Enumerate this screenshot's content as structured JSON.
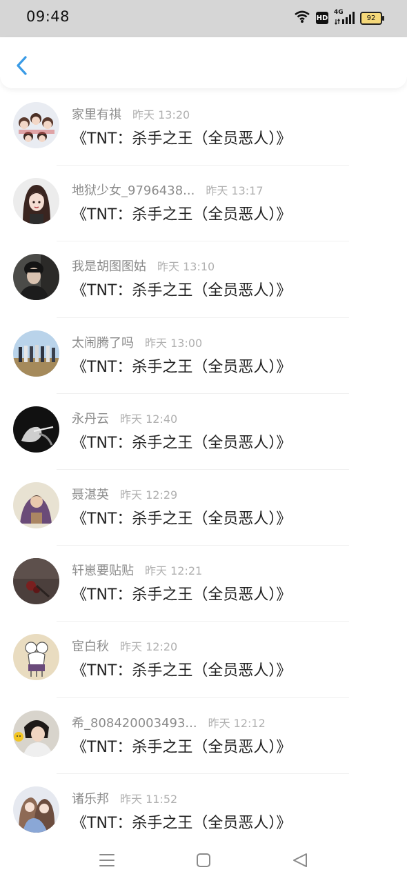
{
  "status_bar": {
    "time": "09:48",
    "network": "4G",
    "hd": "HD",
    "battery": "92"
  },
  "header": {
    "back_icon": "chevron-left-icon",
    "accent": "#3a9be6"
  },
  "messages": [
    {
      "nickname": "家里有祺",
      "time": "昨天 13:20",
      "text": "《TNT：杀手之王（全员恶人）》"
    },
    {
      "nickname": "地狱少女_9796438...",
      "time": "昨天 13:17",
      "text": "《TNT：杀手之王（全员恶人）》"
    },
    {
      "nickname": "我是胡图图姑",
      "time": "昨天 13:10",
      "text": "《TNT：杀手之王（全员恶人）》"
    },
    {
      "nickname": "太闹腾了吗",
      "time": "昨天 13:00",
      "text": "《TNT：杀手之王（全员恶人）》"
    },
    {
      "nickname": "永丹云",
      "time": "昨天 12:40",
      "text": "《TNT：杀手之王（全员恶人）》"
    },
    {
      "nickname": "聂湛英",
      "time": "昨天 12:29",
      "text": "《TNT：杀手之王（全员恶人）》"
    },
    {
      "nickname": "轩崽要贴贴",
      "time": "昨天 12:21",
      "text": "《TNT：杀手之王（全员恶人）》"
    },
    {
      "nickname": "宦白秋",
      "time": "昨天 12:20",
      "text": "《TNT：杀手之王（全员恶人）》"
    },
    {
      "nickname": "希_808420003493...",
      "time": "昨天 12:12",
      "text": "《TNT：杀手之王（全员恶人）》"
    },
    {
      "nickname": "诸乐邦",
      "time": "昨天 11:52",
      "text": "《TNT：杀手之王（全员恶人）》"
    }
  ],
  "nav_bar": {
    "menu_icon": "menu-icon",
    "home_icon": "home-square-icon",
    "back_icon": "back-triangle-icon"
  }
}
